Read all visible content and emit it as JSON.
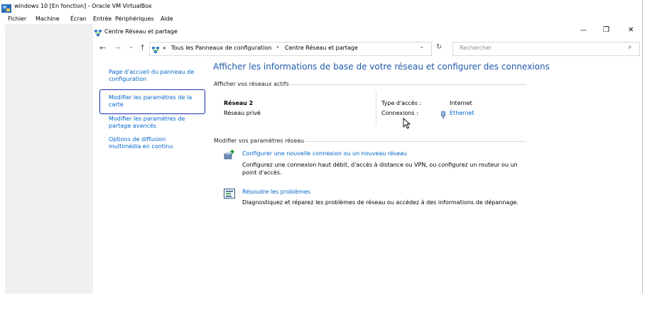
{
  "host_window": {
    "title": "windows 10 [En fonction] - Oracle VM VirtualBox",
    "menu": [
      "Fichier",
      "Machine",
      "Écran",
      "Entrée",
      "Périphériques",
      "Aide"
    ]
  },
  "explorer": {
    "title": "Centre Réseau et partage",
    "controls": {
      "minimize": "—",
      "maximize": "❐",
      "close": "✕"
    },
    "nav": {
      "back": "←",
      "forward": "→",
      "recent": "⌄",
      "up": "↑"
    },
    "breadcrumb": {
      "overflow": "«",
      "items": [
        "Tous les Panneaux de configuration",
        "Centre Réseau et partage"
      ],
      "separator": "›"
    },
    "address_dropdown": "⌄",
    "refresh": "↻",
    "search_placeholder": "Rechercher",
    "search_icon": "⌕"
  },
  "sidebar": {
    "items": [
      {
        "line1": "Page d'accueil du panneau de",
        "line2": "configuration"
      },
      {
        "line1": "Modifier les paramètres de la",
        "line2": "carte"
      },
      {
        "line1": "Modifier les paramètres de",
        "line2": "partage avancés"
      },
      {
        "line1": "Options de diffusion",
        "line2": "multimédia en continu"
      }
    ]
  },
  "main": {
    "heading": "Afficher les informations de base de votre réseau et configurer des connexions",
    "active_networks_label": "Afficher vos réseaux actifs",
    "network": {
      "name": "Réseau 2",
      "type": "Réseau privé",
      "access_type_label": "Type d'accès :",
      "access_type_value": "Internet",
      "connections_label": "Connexions :",
      "connections_value": "Ethernet"
    },
    "modify_label": "Modifier vos paramètres réseau",
    "tasks": [
      {
        "link": "Configurer une nouvelle connexion ou un nouveau réseau",
        "desc1": "Configurez une connexion haut débit, d'accès à distance ou VPN, ou configurez un routeur ou un",
        "desc2": "point d'accès."
      },
      {
        "link": "Résoudre les problèmes",
        "desc1": "Diagnostiquez et réparez les problèmes de réseau ou accédez à des informations de dépannage."
      }
    ]
  }
}
